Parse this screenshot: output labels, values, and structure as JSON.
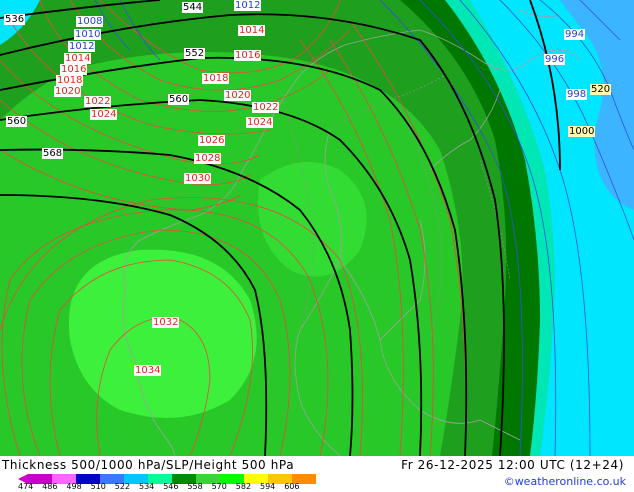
{
  "title": "Thickness 500/1000 hPa/SLP/Height 500 hPa",
  "valid_time": "Fr 26-12-2025 12:00 UTC (12+24)",
  "credit": "©weatheronline.co.uk",
  "scale_labels": [
    "474",
    "486",
    "498",
    "510",
    "522",
    "534",
    "546",
    "558",
    "570",
    "582",
    "594",
    "606"
  ],
  "scale_colors": [
    "#c800c8",
    "#ff66ff",
    "#0000c8",
    "#3c78ff",
    "#00c8ff",
    "#00ff96",
    "#008c00",
    "#3cd23c",
    "#00ff00",
    "#ffff00",
    "#ffc800",
    "#ff8c00"
  ],
  "labels": {
    "h536": "536",
    "h544": "544",
    "h552": "552",
    "h560a": "560",
    "h560b": "560",
    "h568": "568",
    "p1008": "1008",
    "p1010": "1010",
    "p1012a": "1012",
    "p1012b": "1012",
    "p1014a": "1014",
    "p1014b": "1014",
    "p1016a": "1016",
    "p1016b": "1016",
    "p1016c": "1016",
    "p1018a": "1018",
    "p1018b": "1018",
    "p1020a": "1020",
    "p1020b": "1020",
    "p1022a": "1022",
    "p1022b": "1022",
    "p1024a": "1024",
    "p1024b": "1024",
    "p1026": "1026",
    "p1028": "1028",
    "p1030": "1030",
    "p1032": "1032",
    "p1034": "1034",
    "p994": "994",
    "p996": "996",
    "p998": "998",
    "p1000": "1000",
    "t520": "520"
  },
  "legend_label_colors": {
    "height_500": "#000000",
    "slp_high": "#e2231a",
    "slp_low": "#1e3fd8"
  }
}
